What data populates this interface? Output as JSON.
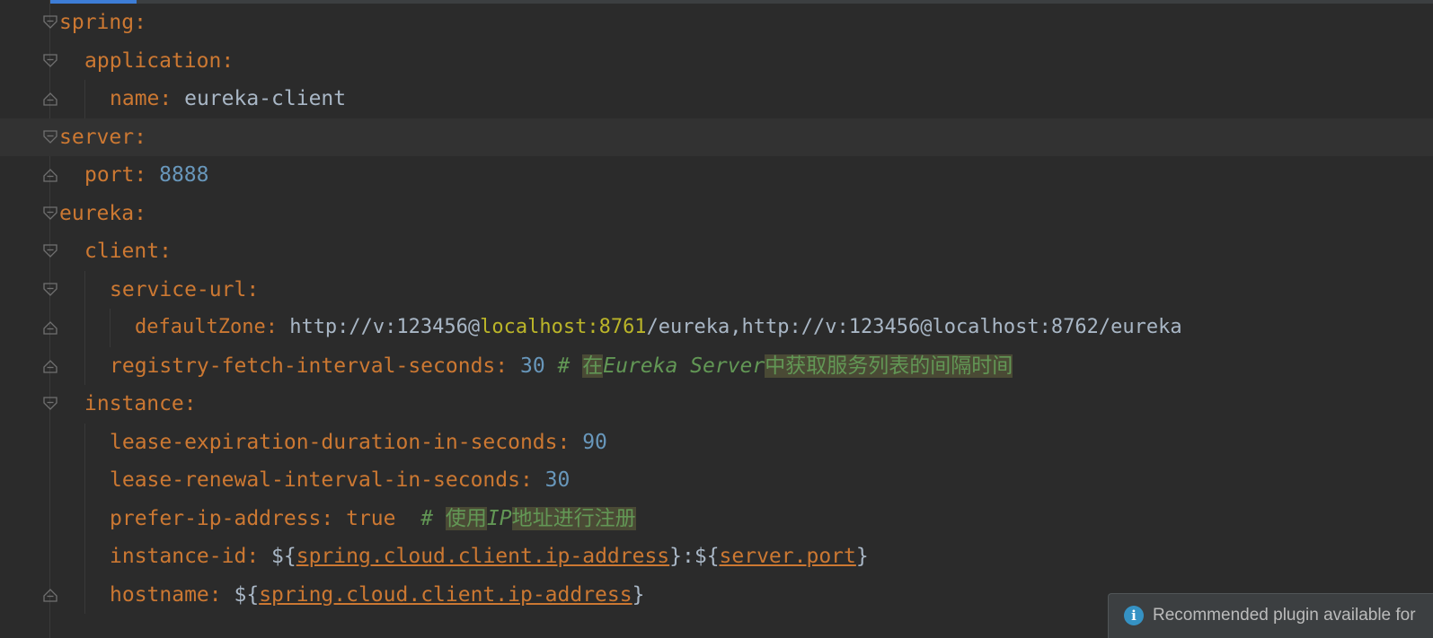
{
  "editor": {
    "colors": {
      "background": "#2b2b2b",
      "key": "#cc7832",
      "plain": "#a9b7c6",
      "number": "#6897bb",
      "comment": "#629755",
      "host_highlight": "#bbb529",
      "progress_accent": "#3d7dd6"
    },
    "progress": 0.095,
    "lines": [
      {
        "key": "spring",
        "colon": ":"
      },
      {
        "key": "application",
        "colon": ":"
      },
      {
        "key": "name",
        "colon": ":",
        "value": " eureka-client"
      },
      {
        "key": "server",
        "colon": ":"
      },
      {
        "key": "port",
        "colon": ":",
        "value": " 8888"
      },
      {
        "key": "eureka",
        "colon": ":"
      },
      {
        "key": "client",
        "colon": ":"
      },
      {
        "key": "service-url",
        "colon": ":"
      },
      {
        "key": "defaultZone",
        "colon": ":",
        "v1": " http://v:123456@",
        "h1": "localhost:8761",
        "v2": "/eureka,http://v:123456",
        "v3": "@localhost:8762/eureka"
      },
      {
        "key": "registry-fetch-interval-seconds",
        "colon": ":",
        "value": " 30",
        "comment_hash": " # ",
        "comment_a": "在",
        "comment_b": "Eureka Server",
        "comment_c": "中获取服务列表的间隔时间"
      },
      {
        "key": "instance",
        "colon": ":"
      },
      {
        "key": "lease-expiration-duration-in-seconds",
        "colon": ":",
        "value": " 90"
      },
      {
        "key": "lease-renewal-interval-in-seconds",
        "colon": ":",
        "value": " 30"
      },
      {
        "key": "prefer-ip-address",
        "colon": ":",
        "value": " true",
        "comment_hash": "  # ",
        "comment_a": "使用",
        "comment_b": "IP",
        "comment_c": "地址进行注册"
      },
      {
        "key": "instance-id",
        "colon": ":",
        "p1": " ${",
        "ref1": "spring.cloud.client.ip-address",
        "p2": "}:${",
        "ref2": "server.port",
        "p3": "}"
      },
      {
        "key": "hostname",
        "colon": ":",
        "p1": " ${",
        "ref1": "spring.cloud.client.ip-address",
        "p2": "}"
      }
    ]
  },
  "notification": {
    "icon": "info-icon",
    "icon_glyph": "i",
    "text": "Recommended plugin available for"
  }
}
